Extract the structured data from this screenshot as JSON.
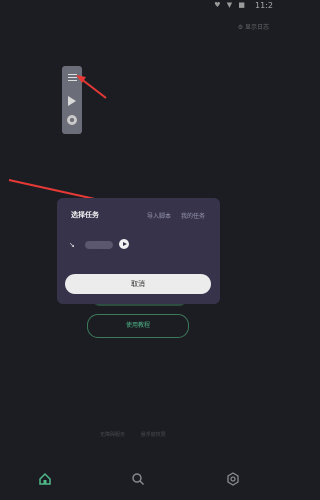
{
  "status_bar": {
    "time": "11:2",
    "icons": "♥ ▼ ■"
  },
  "top_right_label": "⚙ 显示日志",
  "dialog": {
    "title": "选择任务",
    "tabs": [
      "导入脚本",
      "我的任务"
    ],
    "task_icon": "↘",
    "cancel_label": "取消"
  },
  "secondary_button": {
    "label": "使用教程"
  },
  "footer": {
    "links": [
      "无障碍服务",
      "悬浮窗权限"
    ]
  },
  "bottom_nav": [
    "home-icon",
    "search-icon",
    "settings-icon"
  ],
  "colors": {
    "background": "#1c1d23",
    "dialog": "#36334a",
    "accent_green": "#4fb98a",
    "arrow_red": "#e53935"
  }
}
